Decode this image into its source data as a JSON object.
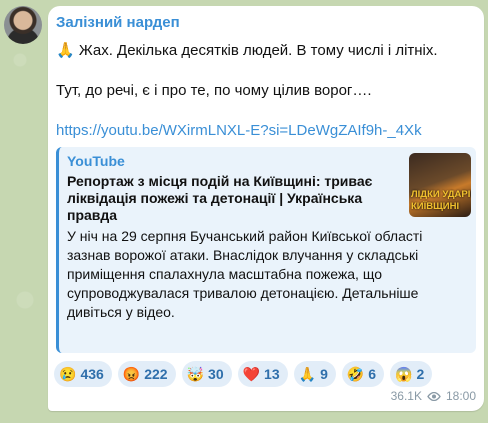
{
  "channel": {
    "name": "Залізний нардеп"
  },
  "message": {
    "line1": "🙏 Жах. Декілька десятків людей. В тому числі і літніх.",
    "line2": "Тут, до речі, є і про те, по чому цілив ворог….",
    "link": "https://youtu.be/WXirmLNXL-E?si=LDeWgZAIf9h-_4Xk"
  },
  "preview": {
    "site": "YouTube",
    "title": "Репортаж з місця подій на Київщині: триває ліквідація пожежі та детонації | Українська правда",
    "description": "У ніч на 29 серпня Бучанський район Київської області зазнав ворожої атаки. Внаслідок влучання у складські приміщення спалахнула масштабна пожежа, що супроводжувалася тривалою детонацією. Детальніше дивіться у відео.\n\n___________________________________________...",
    "thumb_line1": "ЛІДКИ УДАРІВ",
    "thumb_line2": "КИЇВЩИНІ"
  },
  "reactions": [
    {
      "emoji": "😢",
      "count": "436"
    },
    {
      "emoji": "😡",
      "count": "222"
    },
    {
      "emoji": "🤯",
      "count": "30"
    },
    {
      "emoji": "❤️",
      "count": "13"
    },
    {
      "emoji": "🙏",
      "count": "9"
    },
    {
      "emoji": "🤣",
      "count": "6"
    },
    {
      "emoji": "😱",
      "count": "2"
    }
  ],
  "meta": {
    "views": "36.1K",
    "time": "18:00"
  },
  "colors": {
    "accent": "#3a8fd6",
    "bubble": "#ffffff",
    "reaction_bg": "#e2edf8"
  }
}
